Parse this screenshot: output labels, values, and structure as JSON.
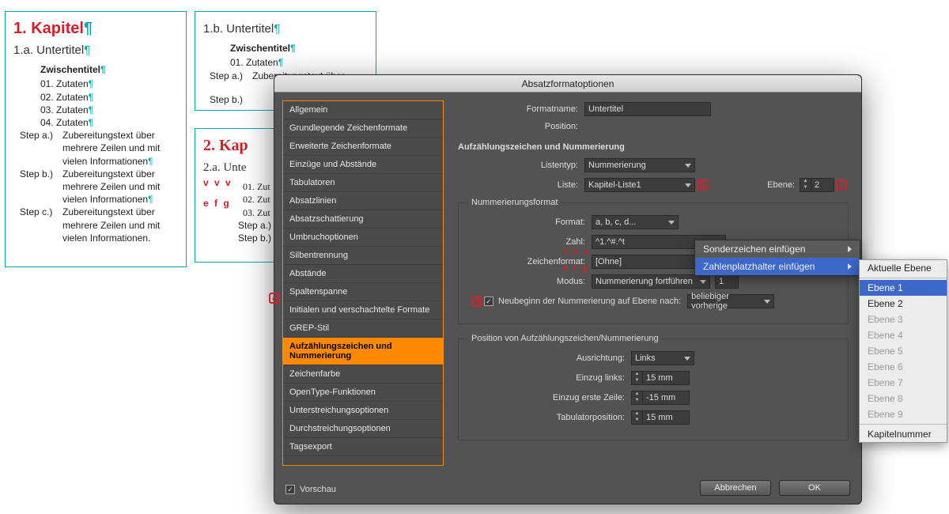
{
  "doc": {
    "page1": {
      "chapter": "1.  Kapitel",
      "subtitle": "1.a.  Untertitel",
      "section": "Zwischentitel",
      "items": [
        "01.  Zutaten",
        "02.  Zutaten",
        "03.  Zutaten",
        "04.  Zutaten"
      ],
      "steps": [
        {
          "lbl": "Step a.)",
          "txt": "Zubereitungstext über mehrere Zeilen und mit vielen Informationen"
        },
        {
          "lbl": "Step b.)",
          "txt": "Zubereitungstext über mehrere Zeilen und mit vielen Informationen"
        },
        {
          "lbl": "Step c.)",
          "txt": "Zubereitungstext über mehrere Zeilen und mit vielen Informationen."
        }
      ]
    },
    "page2": {
      "subtitle": "1.b.  Untertitel",
      "section": "Zwischentitel",
      "items": [
        "01.  Zutaten"
      ],
      "step_lbl": "Step a.)",
      "step_txt": "Zubereitungstext über",
      "step2_lbl": "Step b.)"
    },
    "page3": {
      "chapter": "2.  Kap",
      "subtitle": "2.a.  Unte",
      "items": [
        "01.  Zut",
        "02.  Zut",
        "03.  Zut"
      ],
      "step_a": "Step a.)",
      "step_b": "Step b.)"
    }
  },
  "annotations": {
    "vvv": "v v v",
    "efg": "e f g",
    "a": "a",
    "b": "b",
    "c": "c",
    "d": "d"
  },
  "dialog": {
    "title": "Absatzformatoptionen",
    "categories": [
      "Allgemein",
      "Grundlegende Zeichenformate",
      "Erweiterte Zeichenformate",
      "Einzüge und Abstände",
      "Tabulatoren",
      "Absatzlinien",
      "Absatzschattierung",
      "Umbruchoptionen",
      "Silbentrennung",
      "Abstände",
      "Spaltenspanne",
      "Initialen und verschachtelte Formate",
      "GREP-Stil",
      "Aufzählungszeichen und Nummerierung",
      "Zeichenfarbe",
      "OpenType-Funktionen",
      "Unterstreichungsoptionen",
      "Durchstreichungsoptionen",
      "Tagsexport"
    ],
    "selected_category": "Aufzählungszeichen und Nummerierung",
    "formatname_label": "Formatname:",
    "formatname_value": "Untertitel",
    "position_label": "Position:",
    "section_title": "Aufzählungszeichen und Nummerierung",
    "listentyp_label": "Listentyp:",
    "listentyp_value": "Nummerierung",
    "liste_label": "Liste:",
    "liste_value": "Kapitel-Liste1",
    "ebene_label": "Ebene:",
    "ebene_value": "2",
    "nummerierungsformat": {
      "legend": "Nummerierungsformat",
      "format_label": "Format:",
      "format_value": "a, b, c, d...",
      "zahl_label": "Zahl:",
      "zahl_value": "^1.^#.^t",
      "zeichenformat_label": "Zeichenformat:",
      "zeichenformat_value": "[Ohne]",
      "modus_label": "Modus:",
      "modus_value": "Nummerierung fortführen",
      "modus_num": "1",
      "neubeginn_label": "Neubeginn der Nummerierung auf Ebene nach:",
      "neubeginn_value": "beliebiger vorherige"
    },
    "position": {
      "legend": "Position von Aufzählungszeichen/Nummerierung",
      "ausrichtung_label": "Ausrichtung:",
      "ausrichtung_value": "Links",
      "einzug_links_label": "Einzug links:",
      "einzug_links_value": "15 mm",
      "einzug_erste_label": "Einzug erste Zeile:",
      "einzug_erste_value": "-15 mm",
      "tabpos_label": "Tabulatorposition:",
      "tabpos_value": "15 mm"
    },
    "vorschau": "Vorschau",
    "abbrechen": "Abbrechen",
    "ok": "OK"
  },
  "ctx1": {
    "items": [
      "Sonderzeichen einfügen",
      "Zahlenplatzhalter einfügen"
    ],
    "selected": "Zahlenplatzhalter einfügen"
  },
  "ctx2": {
    "top": "Aktuelle Ebene",
    "items": [
      "Ebene 1",
      "Ebene 2",
      "Ebene 3",
      "Ebene 4",
      "Ebene 5",
      "Ebene 6",
      "Ebene 7",
      "Ebene 8",
      "Ebene 9"
    ],
    "enabled_count": 2,
    "selected": "Ebene 1",
    "bottom": "Kapitelnummer"
  }
}
